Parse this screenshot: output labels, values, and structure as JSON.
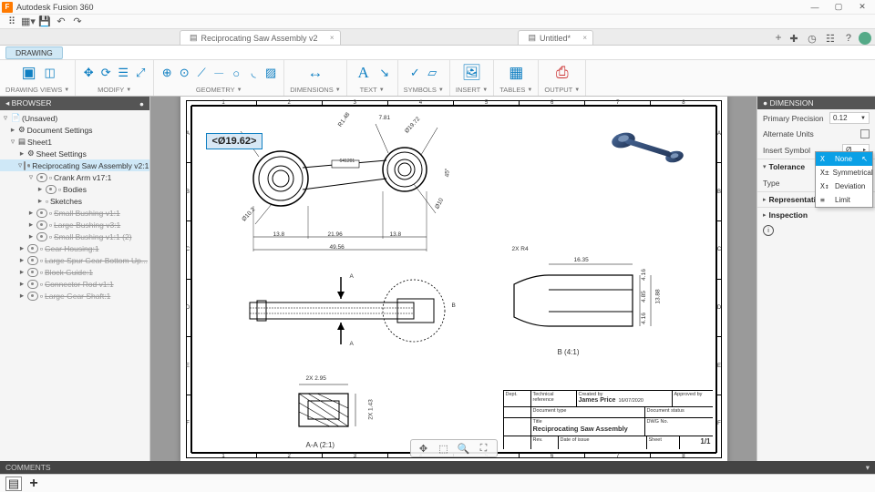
{
  "app": {
    "title": "Autodesk Fusion 360"
  },
  "window_buttons": {
    "min": "—",
    "max": "▢",
    "close": "✕"
  },
  "tabs": [
    {
      "label": "Reciprocating Saw Assembly v2",
      "icon": "drawing",
      "close": "×"
    },
    {
      "label": "Untitled*",
      "icon": "drawing",
      "close": "×"
    }
  ],
  "tab_right_icons": [
    "plus",
    "cloud",
    "grid",
    "bell",
    "help",
    "avatar"
  ],
  "context": "DRAWING",
  "ribbon": [
    {
      "label": "DRAWING VIEWS",
      "icons": [
        "base-view",
        "projected-view"
      ]
    },
    {
      "label": "MODIFY",
      "icons": [
        "move",
        "rotate",
        "align",
        "scale"
      ]
    },
    {
      "label": "GEOMETRY",
      "icons": [
        "centerline",
        "center-mark",
        "edge-ext",
        "line",
        "circle",
        "arc",
        "hatch"
      ]
    },
    {
      "label": "DIMENSIONS",
      "icons": [
        "dimension"
      ]
    },
    {
      "label": "TEXT",
      "icons": [
        "text",
        "leader"
      ]
    },
    {
      "label": "SYMBOLS",
      "icons": [
        "surface",
        "datum"
      ]
    },
    {
      "label": "INSERT",
      "icons": [
        "image"
      ]
    },
    {
      "label": "TABLES",
      "icons": [
        "table"
      ]
    },
    {
      "label": "OUTPUT",
      "icons": [
        "pdf"
      ]
    }
  ],
  "browser": {
    "title": "BROWSER",
    "root": "(Unsaved)",
    "nodes": [
      {
        "label": "Document Settings",
        "indent": 1,
        "tw": "▸",
        "eye": false,
        "gear": true
      },
      {
        "label": "Sheet1",
        "indent": 1,
        "tw": "▿",
        "eye": false,
        "sheet": true
      },
      {
        "label": "Sheet Settings",
        "indent": 2,
        "tw": "▸",
        "eye": false,
        "gear": true
      },
      {
        "label": "Reciprocating Saw Assembly v2:1",
        "indent": 2,
        "tw": "▿",
        "eye": true,
        "hl": true
      },
      {
        "label": "Crank Arm v17:1",
        "indent": 3,
        "tw": "▿",
        "eye": true
      },
      {
        "label": "Bodies",
        "indent": 4,
        "tw": "▸",
        "eye": true
      },
      {
        "label": "Sketches",
        "indent": 4,
        "tw": "▸",
        "eye": false
      },
      {
        "label": "Small Bushing v1:1",
        "indent": 3,
        "tw": "▸",
        "eye": true,
        "strike": true
      },
      {
        "label": "Large Bushing v3:1",
        "indent": 3,
        "tw": "▸",
        "eye": true,
        "strike": true
      },
      {
        "label": "Small Bushing v1:1 (2)",
        "indent": 3,
        "tw": "▸",
        "eye": true,
        "strike": true
      },
      {
        "label": "Gear Housing:1",
        "indent": 2,
        "tw": "▸",
        "eye": true,
        "strike": true
      },
      {
        "label": "Large Spur Gear Bottom Up...",
        "indent": 2,
        "tw": "▸",
        "eye": true,
        "strike": true
      },
      {
        "label": "Block Guide:1",
        "indent": 2,
        "tw": "▸",
        "eye": true,
        "strike": true
      },
      {
        "label": "Connector Rod v1:1",
        "indent": 2,
        "tw": "▸",
        "eye": true,
        "strike": true
      },
      {
        "label": "Large Gear Shaft:1",
        "indent": 2,
        "tw": "▸",
        "eye": true,
        "strike": true
      }
    ]
  },
  "sheet": {
    "edit_value": "<Ø19.62>",
    "cols": [
      "1",
      "2",
      "3",
      "4",
      "5",
      "6",
      "7",
      "8"
    ],
    "rows": [
      "A",
      "B",
      "C",
      "D",
      "E",
      "F"
    ],
    "top_dims": {
      "r148": "R1.48",
      "d1972": "Ø19.72",
      "a781": "7.81",
      "p641201": "641201",
      "d102": "Ø10.2",
      "w138a": "13.8",
      "w2196": "21.96",
      "w138b": "13.8",
      "w4956": "49.56",
      "d10": "Ø10",
      "a45": "45°"
    },
    "mid": {
      "A": "A",
      "Aarrow": "A",
      "B": "B",
      "label": "B (4:1)",
      "r4": "2X R4",
      "w1635": "16.35",
      "h416a": "4.16",
      "h485": "4.85",
      "h416b": "4.16",
      "h1388": "13.88"
    },
    "detail": {
      "label": "A-A (2:1)",
      "w295": "2X 2.95",
      "h143": "2X 1.43"
    },
    "title_block": {
      "dept": "Dept.",
      "tech_ref": "Technical reference",
      "created": "Created by",
      "creator": "James Price",
      "date": "16/07/2020",
      "approved": "Approved by",
      "doc_type": "Document type",
      "doc_status": "Document status",
      "title": "Title",
      "dwg_no": "DWG No.",
      "name": "Reciprocating Saw Assembly",
      "rev": "Rev.",
      "doi": "Date of issue",
      "sheet": "Sheet",
      "scale": "1/1"
    }
  },
  "dim_panel": {
    "title": "DIMENSION",
    "primary_precision": {
      "label": "Primary Precision",
      "value": "0.12"
    },
    "alt_units": {
      "label": "Alternate Units"
    },
    "insert_symbol": {
      "label": "Insert Symbol",
      "value": "Ø"
    },
    "tolerance_hdr": "Tolerance",
    "type": {
      "label": "Type",
      "value": "None"
    },
    "representation": "Representation",
    "inspection": "Inspection",
    "options": [
      {
        "icon": "X",
        "label": "None"
      },
      {
        "icon": "X±",
        "label": "Symmetrical"
      },
      {
        "icon": "X↕",
        "label": "Deviation"
      },
      {
        "icon": "≡",
        "label": "Limit"
      }
    ]
  },
  "comments": "COMMENTS"
}
